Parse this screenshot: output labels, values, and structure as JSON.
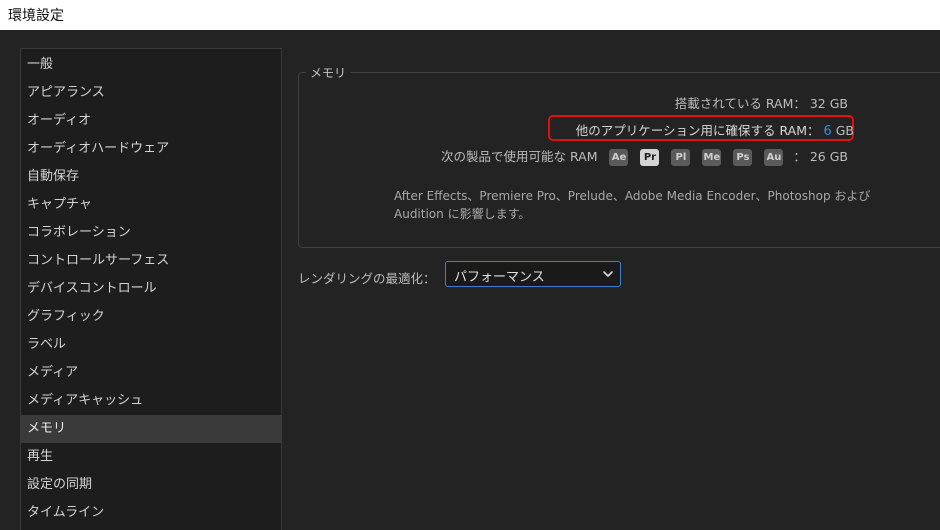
{
  "window": {
    "title": "環境設定"
  },
  "sidebar": {
    "items": [
      {
        "label": "一般"
      },
      {
        "label": "アピアランス"
      },
      {
        "label": "オーディオ"
      },
      {
        "label": "オーディオハードウェア"
      },
      {
        "label": "自動保存"
      },
      {
        "label": "キャプチャ"
      },
      {
        "label": "コラボレーション"
      },
      {
        "label": "コントロールサーフェス"
      },
      {
        "label": "デバイスコントロール"
      },
      {
        "label": "グラフィック"
      },
      {
        "label": "ラベル"
      },
      {
        "label": "メディア"
      },
      {
        "label": "メディアキャッシュ"
      },
      {
        "label": "メモリ"
      },
      {
        "label": "再生"
      },
      {
        "label": "設定の同期"
      },
      {
        "label": "タイムライン"
      }
    ],
    "selected": "メモリ"
  },
  "memory": {
    "group_label": "メモリ",
    "installed_label": "搭載されている RAM：",
    "installed_value": "32 GB",
    "reserved_label": "他のアプリケーション用に確保する RAM：",
    "reserved_value": "6",
    "reserved_unit": "GB",
    "available_label": "次の製品で使用可能な RAM",
    "available_value": "：  26 GB",
    "apps": [
      {
        "label": "Ae",
        "active": false
      },
      {
        "label": "Pr",
        "active": true
      },
      {
        "label": "Pl",
        "active": false
      },
      {
        "label": "Me",
        "active": false
      },
      {
        "label": "Ps",
        "active": false
      },
      {
        "label": "Au",
        "active": false
      }
    ],
    "note": "After Effects、Premiere Pro、Prelude、Adobe Media Encoder、Photoshop および Audition に影響します。",
    "highlight_color": "#e01010",
    "value_color": "#3b8de0"
  },
  "rendering": {
    "label": "レンダリングの最適化：",
    "value": "パフォーマンス",
    "icon": "chevron-down-icon"
  }
}
